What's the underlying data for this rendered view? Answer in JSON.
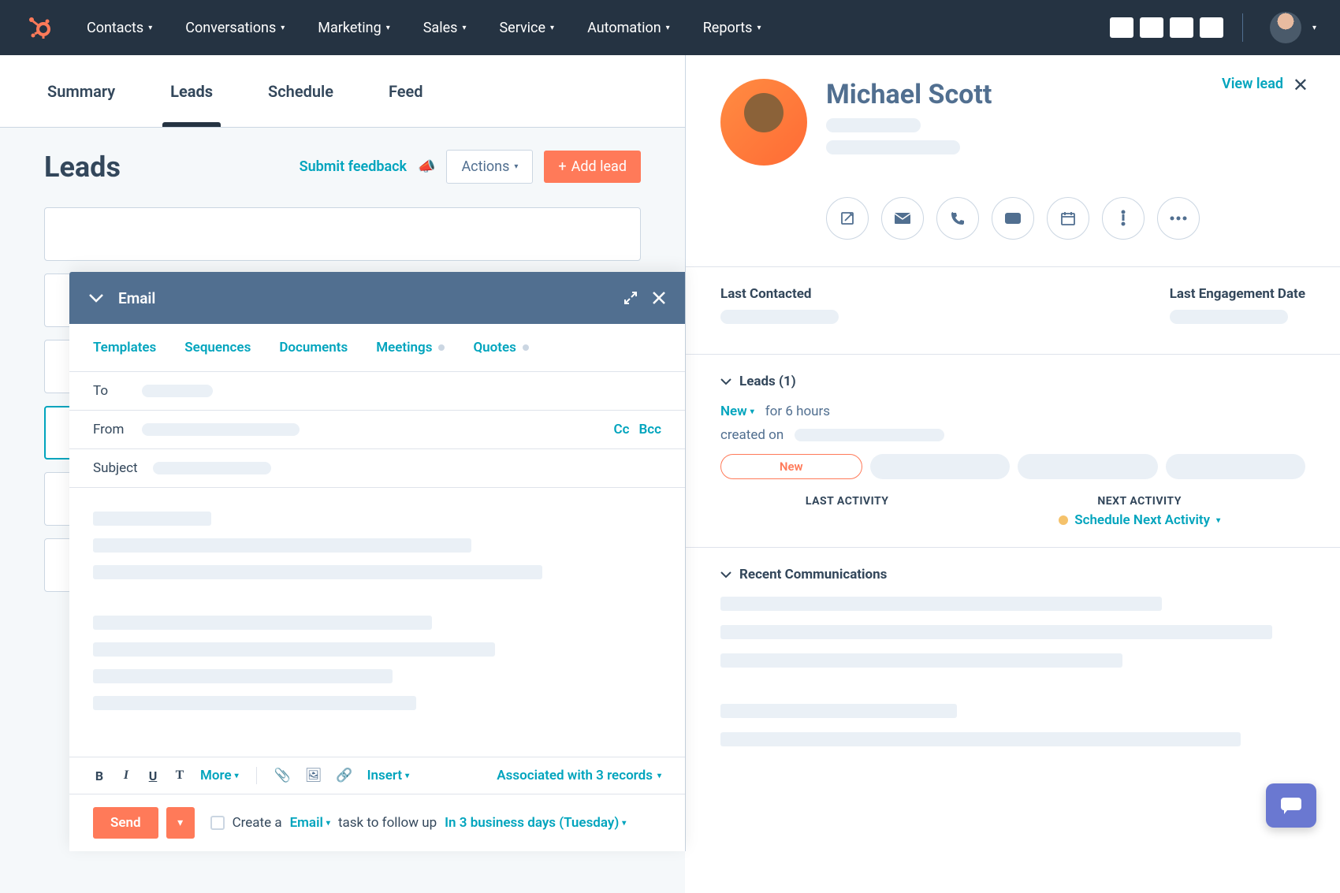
{
  "nav": {
    "items": [
      "Contacts",
      "Conversations",
      "Marketing",
      "Sales",
      "Service",
      "Automation",
      "Reports"
    ]
  },
  "tabs": {
    "items": [
      "Summary",
      "Leads",
      "Schedule",
      "Feed"
    ],
    "active": "Leads"
  },
  "leads": {
    "title": "Leads",
    "feedback": "Submit feedback",
    "actions": "Actions",
    "add": "Add lead"
  },
  "email": {
    "title": "Email",
    "toolbar": [
      "Templates",
      "Sequences",
      "Documents",
      "Meetings",
      "Quotes"
    ],
    "to_label": "To",
    "from_label": "From",
    "cc": "Cc",
    "bcc": "Bcc",
    "subject_label": "Subject",
    "more": "More",
    "insert": "Insert",
    "associated": "Associated with 3 records",
    "send": "Send",
    "create_a": "Create a",
    "create_type": "Email",
    "followup": "task to follow up",
    "followup_time": "In 3 business days (Tuesday)"
  },
  "profile": {
    "name": "Michael Scott",
    "view_lead": "View lead"
  },
  "info": {
    "last_contacted": "Last Contacted",
    "last_engagement": "Last Engagement Date"
  },
  "leads_section": {
    "title": "Leads (1)",
    "status": "New",
    "duration": "for 6 hours",
    "created": "created on",
    "stage_new": "New",
    "last_activity": "LAST ACTIVITY",
    "next_activity": "NEXT ACTIVITY",
    "schedule_next": "Schedule Next Activity"
  },
  "communications": {
    "title": "Recent Communications"
  }
}
